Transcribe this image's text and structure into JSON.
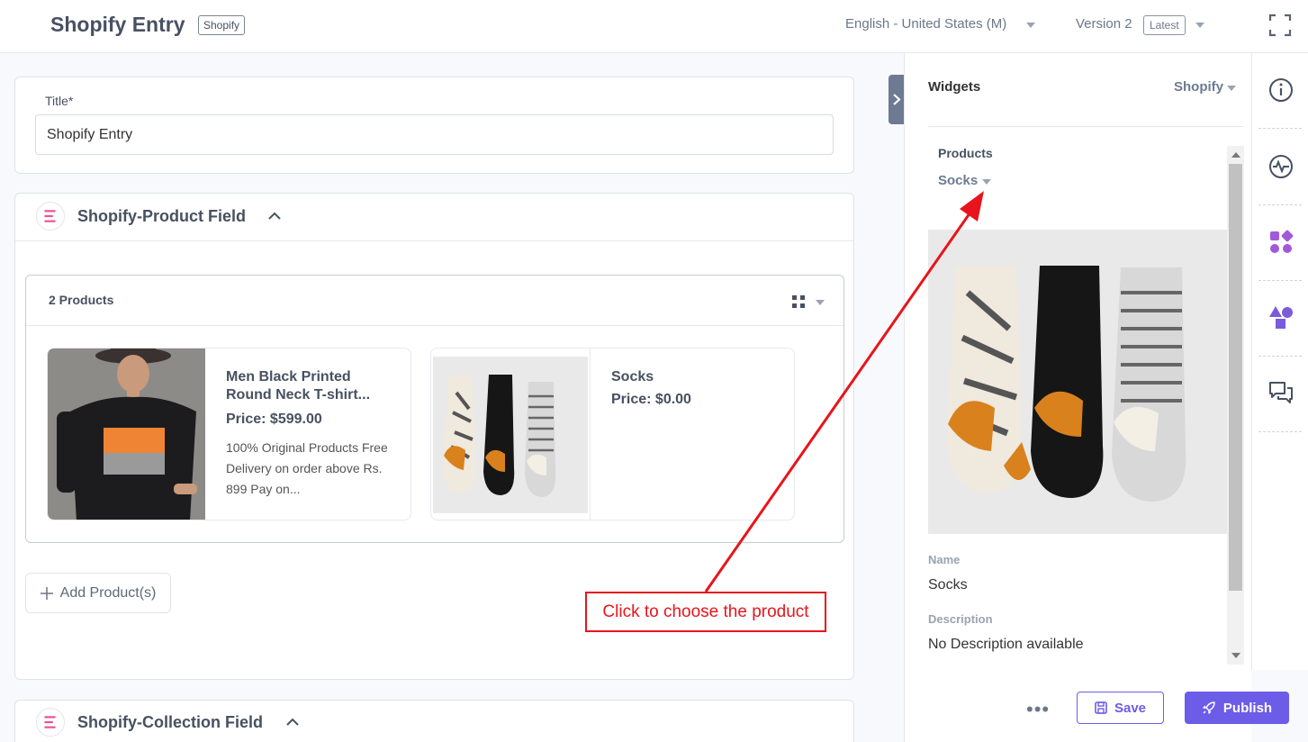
{
  "header": {
    "title": "Shopify Entry",
    "badge": "Shopify",
    "locale": "English - United States (M)",
    "version": "Version 2",
    "version_tag": "Latest"
  },
  "entry": {
    "title_label": "Title*",
    "title_value": "Shopify Entry"
  },
  "product_field": {
    "title": "Shopify-Product Field",
    "count_label": "2 Products",
    "products": [
      {
        "name": "Men Black Printed Round Neck T-shirt...",
        "price": "Price: $599.00",
        "description": "100% Original Products Free Delivery on order above Rs. 899 Pay on..."
      },
      {
        "name": "Socks",
        "price": "Price: $0.00",
        "description": ""
      }
    ],
    "add_label": "Add Product(s)"
  },
  "collection_field": {
    "title": "Shopify-Collection Field"
  },
  "widgets": {
    "title": "Widgets",
    "selector": "Shopify",
    "products_label": "Products",
    "selected_product": "Socks",
    "name_label": "Name",
    "name_value": "Socks",
    "description_label": "Description",
    "description_value": "No Description available"
  },
  "actions": {
    "more": "•••",
    "save": "Save",
    "publish": "Publish"
  },
  "annotation": {
    "callout": "Click to choose the product"
  },
  "colors": {
    "accent": "#6c5ce7",
    "annotation": "#e8141b"
  }
}
